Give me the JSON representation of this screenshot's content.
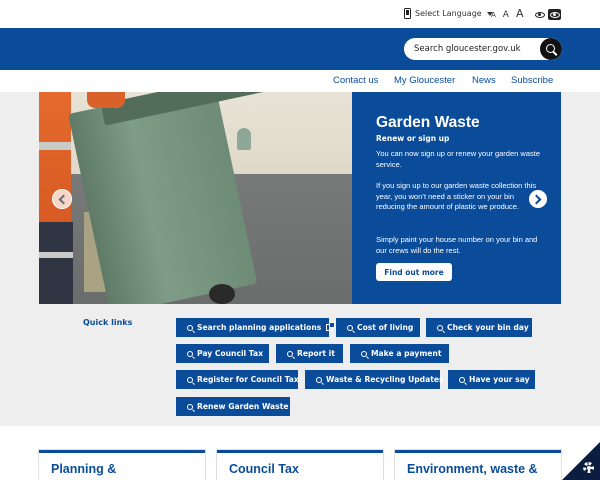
{
  "utility": {
    "language_label": "Select Language",
    "font_small": "A",
    "font_medium": "A",
    "font_large": "A"
  },
  "search": {
    "placeholder": "Search gloucester.gov.uk"
  },
  "nav": {
    "items": [
      {
        "label": "Contact us"
      },
      {
        "label": "My Gloucester"
      },
      {
        "label": "News"
      },
      {
        "label": "Subscribe"
      }
    ]
  },
  "hero": {
    "title": "Garden Waste",
    "subtitle": "Renew or sign up",
    "para1": "You can now sign up or renew your garden waste service.",
    "para2": "If you sign up to our garden waste collection this year, you won’t need a sticker on your bin reducing the amount of plastic we produce.",
    "para3": "Simply paint your house number on your bin and our crews will do the rest.",
    "cta_label": "Find out more"
  },
  "quick_links": {
    "title": "Quick links",
    "items": [
      {
        "label": "Search planning applications"
      },
      {
        "label": "Cost of living"
      },
      {
        "label": "Check your bin day"
      },
      {
        "label": "Pay Council Tax"
      },
      {
        "label": "Report it"
      },
      {
        "label": "Make a payment"
      },
      {
        "label": "Register for Council Tax"
      },
      {
        "label": "Waste & Recycling Updates"
      },
      {
        "label": "Have your say"
      },
      {
        "label": "Renew Garden Waste"
      }
    ]
  },
  "cards": [
    {
      "title": "Planning &"
    },
    {
      "title": "Council Tax"
    },
    {
      "title": "Environment, waste &"
    }
  ],
  "colors": {
    "brand_blue": "#0a4c9a",
    "band_grey": "#eeeeee"
  }
}
